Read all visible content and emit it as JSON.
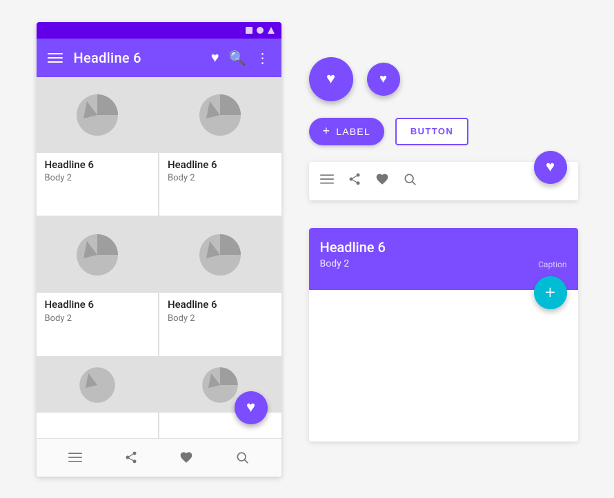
{
  "phone": {
    "statusBar": {
      "icons": [
        "rect",
        "circle",
        "triangle"
      ]
    },
    "appBar": {
      "title": "Headline 6",
      "menuIcon": "menu-icon",
      "heartIcon": "favorite-icon",
      "searchIcon": "search-icon",
      "moreIcon": "more-vert-icon"
    },
    "grid": {
      "cells": [
        {
          "headline": "Headline 6",
          "body": "Body 2"
        },
        {
          "headline": "Headline 6",
          "body": "Body 2"
        },
        {
          "headline": "Headline 6",
          "body": "Body 2"
        },
        {
          "headline": "Headline 6",
          "body": "Body 2"
        },
        {
          "headline": "",
          "body": ""
        },
        {
          "headline": "",
          "body": ""
        }
      ]
    },
    "fab": {
      "icon": "favorite-icon",
      "label": "+"
    },
    "bottomNav": {
      "icons": [
        "menu-icon",
        "share-icon",
        "favorite-icon",
        "search-icon"
      ]
    }
  },
  "rightPanel": {
    "fabs": {
      "large": {
        "icon": "♥",
        "size": "large"
      },
      "small": {
        "icon": "♥",
        "size": "small"
      }
    },
    "buttons": {
      "extendedFab": {
        "label": "LABEL",
        "plusSign": "+"
      },
      "outlined": {
        "label": "BUTTON"
      }
    },
    "bottomAppBar": {
      "icons": [
        "menu-icon",
        "share-icon",
        "favorite-icon",
        "search-icon"
      ],
      "fab": {
        "icon": "♥"
      }
    },
    "card": {
      "headline": "Headline 6",
      "body": "Body 2",
      "caption": "Caption",
      "fab": {
        "icon": "+"
      }
    }
  }
}
